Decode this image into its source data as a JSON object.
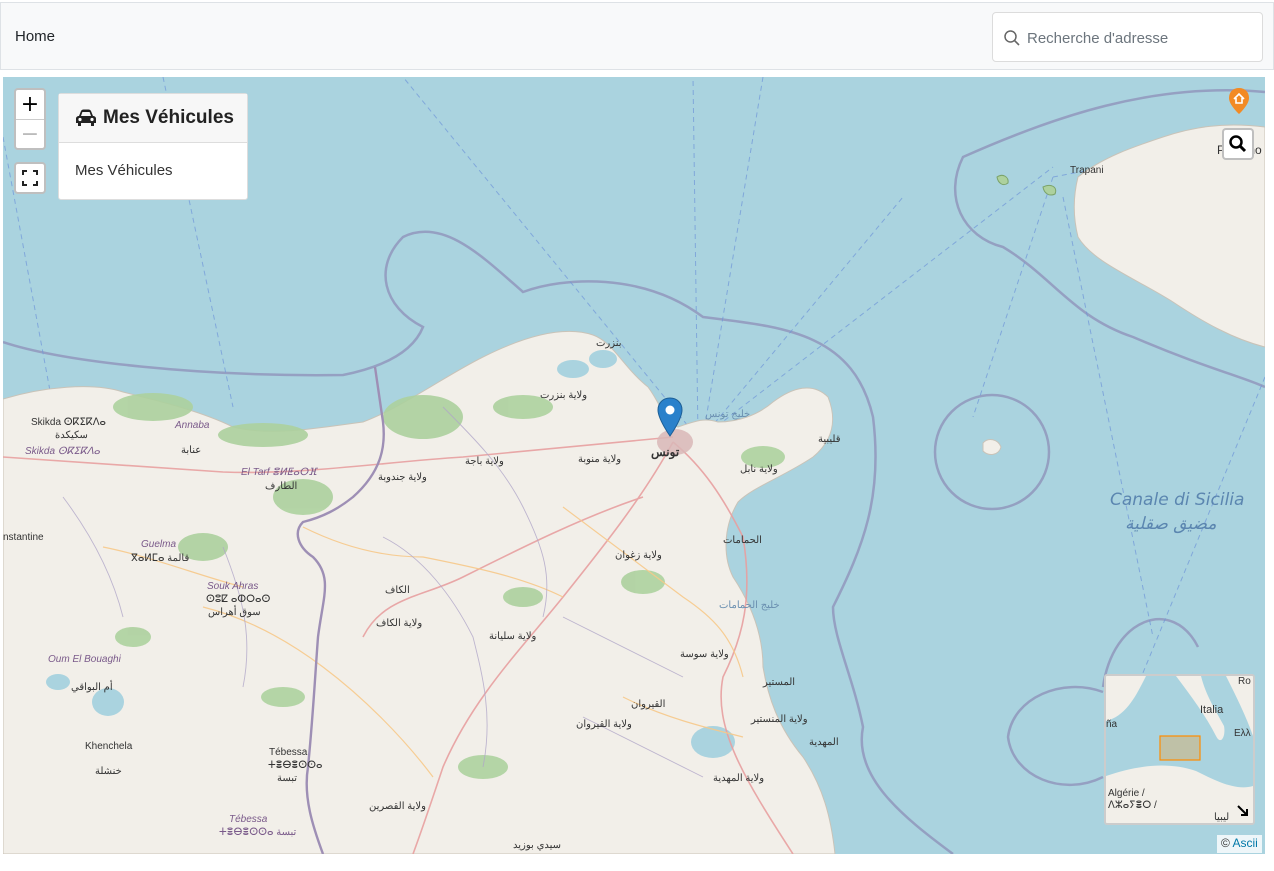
{
  "header": {
    "breadcrumb": "Home",
    "search_placeholder": "Recherche d'adresse"
  },
  "map": {
    "zoom_in": "+",
    "zoom_out": "−",
    "vehicles_panel": {
      "title": "Mes Véhicules",
      "body": "Mes Véhicules"
    },
    "labels": {
      "skikda": "Skikda ⵙⴽⵉⴽⴷⴰ",
      "skikda_ar": "سكيكدة",
      "annaba": "Annaba",
      "annaba_ar": "عنابة",
      "el_tarf": "El Tarf ⴻⵍⵟⴰⵔⴼ",
      "el_tarf_ar": "الطارف",
      "guelma": "Guelma",
      "guelma_ar": "ⴳⴰⵍⵎⴰ قالمة",
      "souk_ahras": "Souk Ahras",
      "souk_ahras_tz": "ⵙⵓⵇ ⴰⵀⵔⴰⵙ",
      "souk_ahras_ar": "سوق أهراس",
      "constantine": "nstantine",
      "oum_el_bouaghi": "Oum El Bouaghi",
      "oum_el_bouaghi_ar": "أم البواقي",
      "khenchela": "Khenchela",
      "khenchela_ar": "خنشلة",
      "tebessa": "Tébessa",
      "tebessa_tz": "ⵜⴻⴱⴻⵙⵙⴰ",
      "tebessa_ar": "تبسة",
      "tebessa2": "Tébessa",
      "tebessa2_ar": "ⵜⴻⴱⴻⵙⵙⴰ تبسة",
      "bizerte": "بنزرت",
      "bizerte_gov": "ولاية بنزرت",
      "tunis": "تونس",
      "beja": "ولاية باجة",
      "manouba": "ولاية منوبة",
      "jendouba": "ولاية جندوبة",
      "zaghouan": "ولاية زغوان",
      "nabeul": "ولاية نابل",
      "kelibia": "قليبية",
      "hammamet": "الحمامات",
      "gulf_hammamet": "خليج الحمامات",
      "gulf_tunis": "خليج تونس",
      "kef_city": "الكاف",
      "kef": "ولاية الكاف",
      "siliana": "ولاية سليانة",
      "sousse": "ولاية سوسة",
      "monastir_city": "المستير",
      "monastir": "ولاية المنستير",
      "kairouan_city": "القيروان",
      "kairouan": "ولاية القيروان",
      "mahdia_city": "المهدية",
      "mahdia": "ولاية المهدية",
      "kasserine": "ولاية القصرين",
      "sidi_bouzid": "سيدي بوزيد",
      "trapani": "Trapani",
      "palermo": "Palermo",
      "canale": "Canale di Sicilia",
      "canale_ar": "مضيق صقلية"
    },
    "minimap_labels": {
      "italia": "Italia",
      "algerie": "Algérie /",
      "algerie2": "ⴷⵣⴰⵢⴻⵔ /",
      "elas": "Ελλ",
      "ro": "Ro",
      "libya": "ليبيا",
      "spain": "ña"
    },
    "attribution_prefix": "©",
    "attribution_link": "Ascii"
  },
  "colors": {
    "sea": "#aad3df",
    "land": "#f2efe9",
    "forest": "#add19e",
    "border": "#9e9cab",
    "marker": "#2a81cb"
  }
}
